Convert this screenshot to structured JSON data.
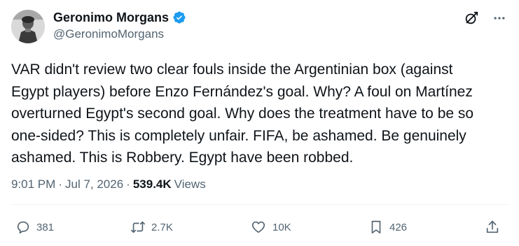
{
  "author": {
    "display_name": "Geronimo Morgans",
    "handle": "@GeronimoMorgans",
    "verified": true
  },
  "tweet": {
    "text": "VAR didn't review two clear fouls inside the Argentinian box (against\nEgypt players) before Enzo Fernández's goal. Why? A foul on Martínez\noverturned Egypt's second goal. Why does the treatment have to be so\none-sided? This is completely unfair. FIFA, be ashamed. Be genuinely\nashamed. This is Robbery. Egypt have been robbed."
  },
  "meta": {
    "time": "9:01 PM",
    "separator": "·",
    "date": "Jul 7, 2026",
    "views_count": "539.4K",
    "views_label": "Views"
  },
  "actions": {
    "replies": "381",
    "reposts": "2.7K",
    "likes": "10K",
    "bookmarks": "426"
  },
  "colors": {
    "text": "#0f1419",
    "secondary": "#536471",
    "verified": "#1d9bf0",
    "divider": "#eff3f4"
  },
  "icons": {
    "verified": "verified-badge-icon",
    "grok": "grok-icon",
    "more": "more-icon",
    "reply": "reply-icon",
    "repost": "repost-icon",
    "like": "like-icon",
    "bookmark": "bookmark-icon",
    "share": "share-icon"
  }
}
